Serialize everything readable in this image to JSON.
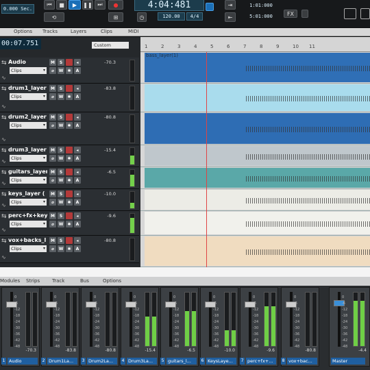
{
  "transport": {
    "time_sec": "0.000 Sec.",
    "big_time": "4:04:481",
    "tempo": "120.00",
    "signature": "4/4",
    "loop_start": "1:01:000",
    "loop_end": "5:01:000",
    "fx_label": "FX"
  },
  "menubar": {
    "items": [
      "Options",
      "Tracks",
      "Layers",
      "Clips",
      "MIDI"
    ]
  },
  "track_panel": {
    "position_time": "00:07.751",
    "preset": "Custom"
  },
  "tracks": [
    {
      "name": "Audio",
      "clips": "Clips",
      "value": "-70.3",
      "meter": 0.0
    },
    {
      "name": "drum1_layer",
      "clips": "Clips",
      "value": "-83.8",
      "meter": 0.0
    },
    {
      "name": "drum2_layer",
      "clips": "Clips",
      "value": "-80.8",
      "meter": 0.0
    },
    {
      "name": "drum3_layer",
      "clips": "Clips",
      "value": "-15.4",
      "meter": 0.55
    },
    {
      "name": "guitars_layer",
      "clips": "Clips",
      "value": "-6.5",
      "meter": 0.7
    },
    {
      "name": "keys_layer (",
      "clips": "Clips",
      "value": "-10.0",
      "meter": 0.35
    },
    {
      "name": "perc+fx+key",
      "clips": "Clips",
      "value": "-9.6",
      "meter": 0.8
    },
    {
      "name": "vox+backs_l",
      "clips": "Clips",
      "value": "-80.8",
      "meter": 0.0
    }
  ],
  "ruler": {
    "marks": [
      "1",
      "2",
      "3",
      "4",
      "5",
      "6",
      "7",
      "8",
      "9",
      "10",
      "11"
    ]
  },
  "lanes": [
    {
      "label": "bass_layer(1)",
      "color": "#2f6fb6"
    },
    {
      "label": "",
      "color": "#a9dced"
    },
    {
      "label": "",
      "color": "#2e6db4"
    },
    {
      "label": "",
      "color": "#bfc7cc"
    },
    {
      "label": "",
      "color": "#5aa8a8"
    },
    {
      "label": "",
      "color": "#ecece6"
    },
    {
      "label": "",
      "color": "#f1f1ec"
    },
    {
      "label": "",
      "color": "#f0dcc0"
    }
  ],
  "console_bar": {
    "items": [
      "Modules",
      "Strips",
      "Track",
      "Bus",
      "Options"
    ]
  },
  "strips": [
    {
      "num": "1",
      "name": "Audio",
      "peak": "-70.3",
      "meter": 0.0
    },
    {
      "num": "2",
      "name": "Drum1La...",
      "peak": "-83.8",
      "meter": 0.0
    },
    {
      "num": "3",
      "name": "Drum2La...",
      "peak": "-80.8",
      "meter": 0.0
    },
    {
      "num": "4",
      "name": "Drum3La...",
      "peak": "-15.4",
      "meter": 0.55
    },
    {
      "num": "5",
      "name": "guitars_l...",
      "peak": "-6.5",
      "meter": 0.65
    },
    {
      "num": "6",
      "name": "KeysLaye...",
      "peak": "-10.0",
      "meter": 0.3
    },
    {
      "num": "7",
      "name": "perc+fx+...",
      "peak": "-9.6",
      "meter": 0.75
    },
    {
      "num": "8",
      "name": "vox+bac...",
      "peak": "-80.8",
      "meter": 0.0
    },
    {
      "num": "",
      "name": "Master",
      "peak": "-4.4",
      "meter": 0.85
    }
  ],
  "scale": [
    "0",
    "-6",
    "-12",
    "-18",
    "-24",
    "-30",
    "-36",
    "-42",
    "-48"
  ]
}
